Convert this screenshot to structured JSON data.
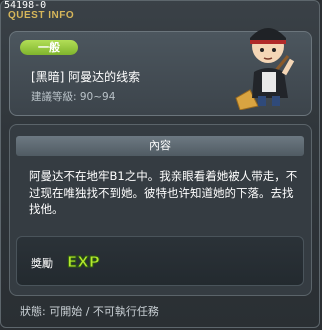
{
  "window": {
    "quest_id": "54198-0",
    "title": "QUEST INFO"
  },
  "quest": {
    "category_badge": "一般",
    "name": "[黑暗] 阿曼达的线索",
    "level_range": "建議等級: 90~94"
  },
  "content": {
    "header": "內容",
    "description": "阿曼达不在地牢B1之中。我亲眼看着她被人带走，不过现在唯独找不到她。彼特也许知道她的下落。去找找他。"
  },
  "reward": {
    "label": "獎勵",
    "exp_text": "EXP"
  },
  "status": {
    "text": "狀態: 可開始 / 不可執行任務"
  },
  "colors": {
    "title": "#d6b65a",
    "badge": "#8fc43a",
    "exp": "#b6ea2e"
  }
}
